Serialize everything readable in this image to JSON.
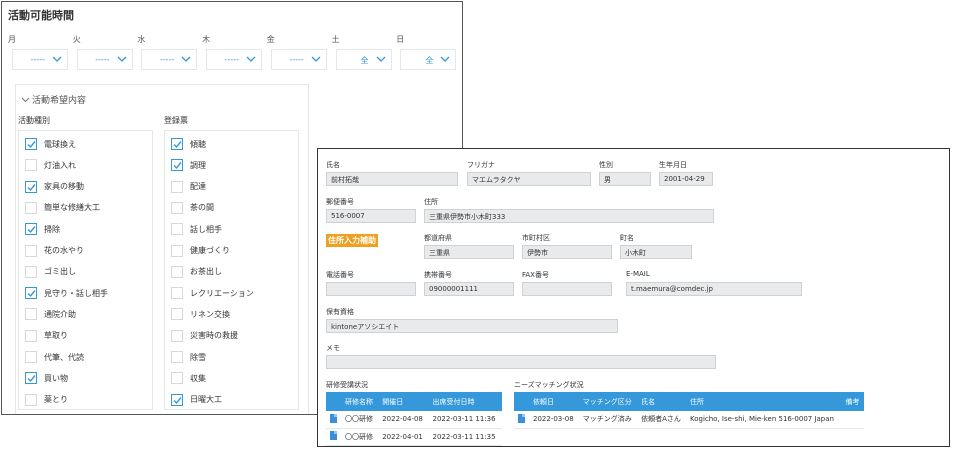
{
  "panel1": {
    "title": "活動可能時間",
    "days": [
      {
        "label": "月",
        "value": "-----"
      },
      {
        "label": "火",
        "value": "-----"
      },
      {
        "label": "水",
        "value": "-----"
      },
      {
        "label": "木",
        "value": "-----"
      },
      {
        "label": "金",
        "value": "-----"
      },
      {
        "label": "土",
        "value": "全"
      },
      {
        "label": "日",
        "value": "全"
      }
    ],
    "section_title": "活動希望内容",
    "col1_label": "活動種別",
    "col2_label": "登録票",
    "col1_items": [
      {
        "label": "電球換え",
        "checked": true
      },
      {
        "label": "灯油入れ",
        "checked": false
      },
      {
        "label": "家具の移動",
        "checked": true
      },
      {
        "label": "簡単な修繕大工",
        "checked": false
      },
      {
        "label": "掃除",
        "checked": true
      },
      {
        "label": "花の水やり",
        "checked": false
      },
      {
        "label": "ゴミ出し",
        "checked": false
      },
      {
        "label": "見守り・話し相手",
        "checked": true
      },
      {
        "label": "通院介助",
        "checked": false
      },
      {
        "label": "草取り",
        "checked": false
      },
      {
        "label": "代筆、代読",
        "checked": false
      },
      {
        "label": "買い物",
        "checked": true
      },
      {
        "label": "薬とり",
        "checked": false
      }
    ],
    "col2_items": [
      {
        "label": "傾聴",
        "checked": true
      },
      {
        "label": "調理",
        "checked": true
      },
      {
        "label": "配達",
        "checked": false
      },
      {
        "label": "茶の間",
        "checked": false
      },
      {
        "label": "話し相手",
        "checked": false
      },
      {
        "label": "健康づくり",
        "checked": false
      },
      {
        "label": "お茶出し",
        "checked": false
      },
      {
        "label": "レクリエーション",
        "checked": false
      },
      {
        "label": "リネン交換",
        "checked": false
      },
      {
        "label": "災害時の救援",
        "checked": false
      },
      {
        "label": "除雪",
        "checked": false
      },
      {
        "label": "収集",
        "checked": false
      },
      {
        "label": "日曜大工",
        "checked": true
      }
    ]
  },
  "panel2": {
    "name_label": "氏名",
    "name_value": "前村拓哉",
    "furigana_label": "フリガナ",
    "furigana_value": "マエムラタクヤ",
    "gender_label": "性別",
    "gender_value": "男",
    "birth_label": "生年月日",
    "birth_value": "2001-04-29",
    "zip_label": "郵便番号",
    "zip_value": "516-0007",
    "address_label": "住所",
    "address_value": "三重県伊勢市小木町333",
    "badge": "住所入力補助",
    "pref_label": "都道府県",
    "pref_value": "三重県",
    "city_label": "市町村区",
    "city_value": "伊勢市",
    "town_label": "町名",
    "town_value": "小木町",
    "phone_label": "電話番号",
    "phone_value": "",
    "mobile_label": "携帯番号",
    "mobile_value": "09000001111",
    "fax_label": "FAX番号",
    "fax_value": "",
    "email_label": "E-MAIL",
    "email_value": "t.maemura@comdec.jp",
    "qual_label": "保有資格",
    "qual_value": "kintoneアソシエイト",
    "memo_label": "メモ",
    "memo_value": "",
    "training_title": "研修受講状況",
    "training_headers": [
      "研修名称",
      "開催日",
      "出席受付日時"
    ],
    "training_rows": [
      [
        "〇〇研修",
        "2022-04-08",
        "2022-03-11 11:36"
      ],
      [
        "〇〇研修",
        "2022-04-01",
        "2022-03-11 11:35"
      ]
    ],
    "needs_title": "ニーズマッチング状況",
    "needs_headers": [
      "依頼日",
      "マッチング区分",
      "氏名",
      "住所",
      "備考"
    ],
    "needs_rows": [
      [
        "2022-03-08",
        "マッチング済み",
        "依頼者Aさん",
        "Kogicho, Ise-shi, Mie-ken 516-0007 Japan",
        ""
      ]
    ]
  },
  "colors": {
    "accent": "#3498db",
    "badge": "#f0a020",
    "field_bg": "#e8eaec"
  }
}
